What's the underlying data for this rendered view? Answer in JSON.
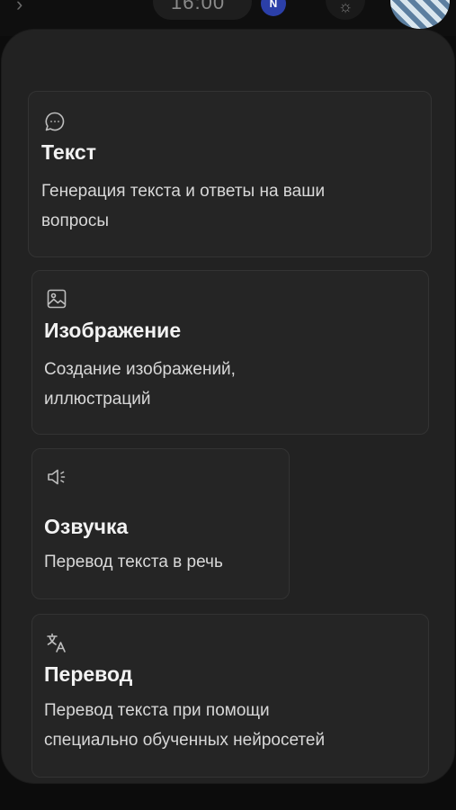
{
  "status_bar": {
    "back_icon": "chevron-left-icon",
    "time": "16:00",
    "badge": "N",
    "brightness_icon": "sun-icon"
  },
  "options": [
    {
      "icon": "chat-bubble-icon",
      "title": "Текст",
      "description_lines": [
        "Генерация текста и ответы на ваши",
        "вопросы"
      ]
    },
    {
      "icon": "image-icon",
      "title": "Изображение",
      "description_lines": [
        "Создание изображений,",
        "иллюстраций"
      ]
    },
    {
      "icon": "speaker-icon",
      "title": "Озвучка",
      "description_lines": [
        "Перевод текста в речь"
      ]
    },
    {
      "icon": "translate-icon",
      "title": "Перевод",
      "description_lines": [
        "Перевод текста при помощи",
        "специально обученных нейросетей"
      ]
    }
  ],
  "colors": {
    "background": "#0c0c0c",
    "sheet": "#222222",
    "card": "#252525",
    "card_border": "#333333",
    "title_text": "#f2f2f2",
    "body_text": "#d8d8d8",
    "icon": "#bdbdbd"
  }
}
